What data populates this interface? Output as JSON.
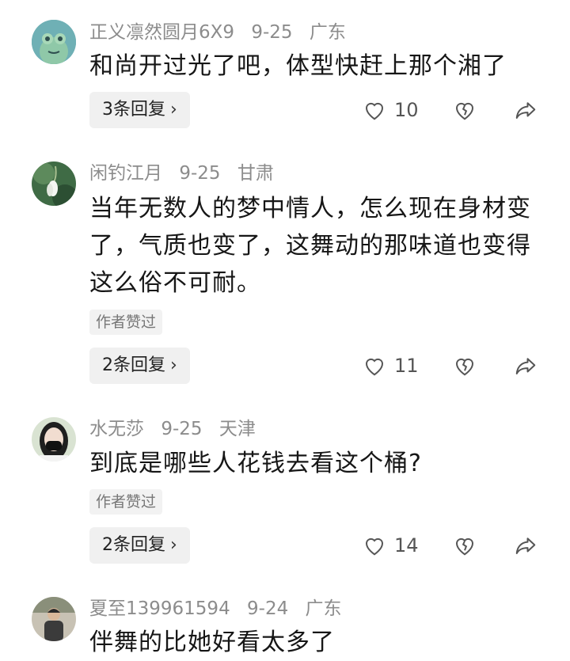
{
  "comments": [
    {
      "username": "正义凛然圆月6X9",
      "date": "9-25",
      "location": "广东",
      "text": "和尚开过光了吧，体型快赶上那个湘了",
      "author_liked": "",
      "replies": "3条回复",
      "likes": "10",
      "avatar": "frog-avatar"
    },
    {
      "username": "闲钓江月",
      "date": "9-25",
      "location": "甘肃",
      "text": "当年无数人的梦中情人，怎么现在身材变了，气质也变了，这舞动的那味道也变得这么俗不可耐。",
      "author_liked": "作者赞过",
      "replies": "2条回复",
      "likes": "11",
      "avatar": "snowdrop-flower-avatar"
    },
    {
      "username": "水无莎",
      "date": "9-25",
      "location": "天津",
      "text": "到底是哪些人花钱去看这个桶?",
      "author_liked": "作者赞过",
      "replies": "2条回复",
      "likes": "14",
      "avatar": "masked-girl-avatar"
    },
    {
      "username": "夏至139961594",
      "date": "9-24",
      "location": "广东",
      "text": "伴舞的比她好看太多了",
      "avatar": "man-photo-avatar"
    }
  ],
  "icons": {
    "like": "heart-outline-icon",
    "dislike": "broken-heart-icon",
    "share": "share-arrow-icon",
    "chevron": "chevron-right-icon"
  }
}
